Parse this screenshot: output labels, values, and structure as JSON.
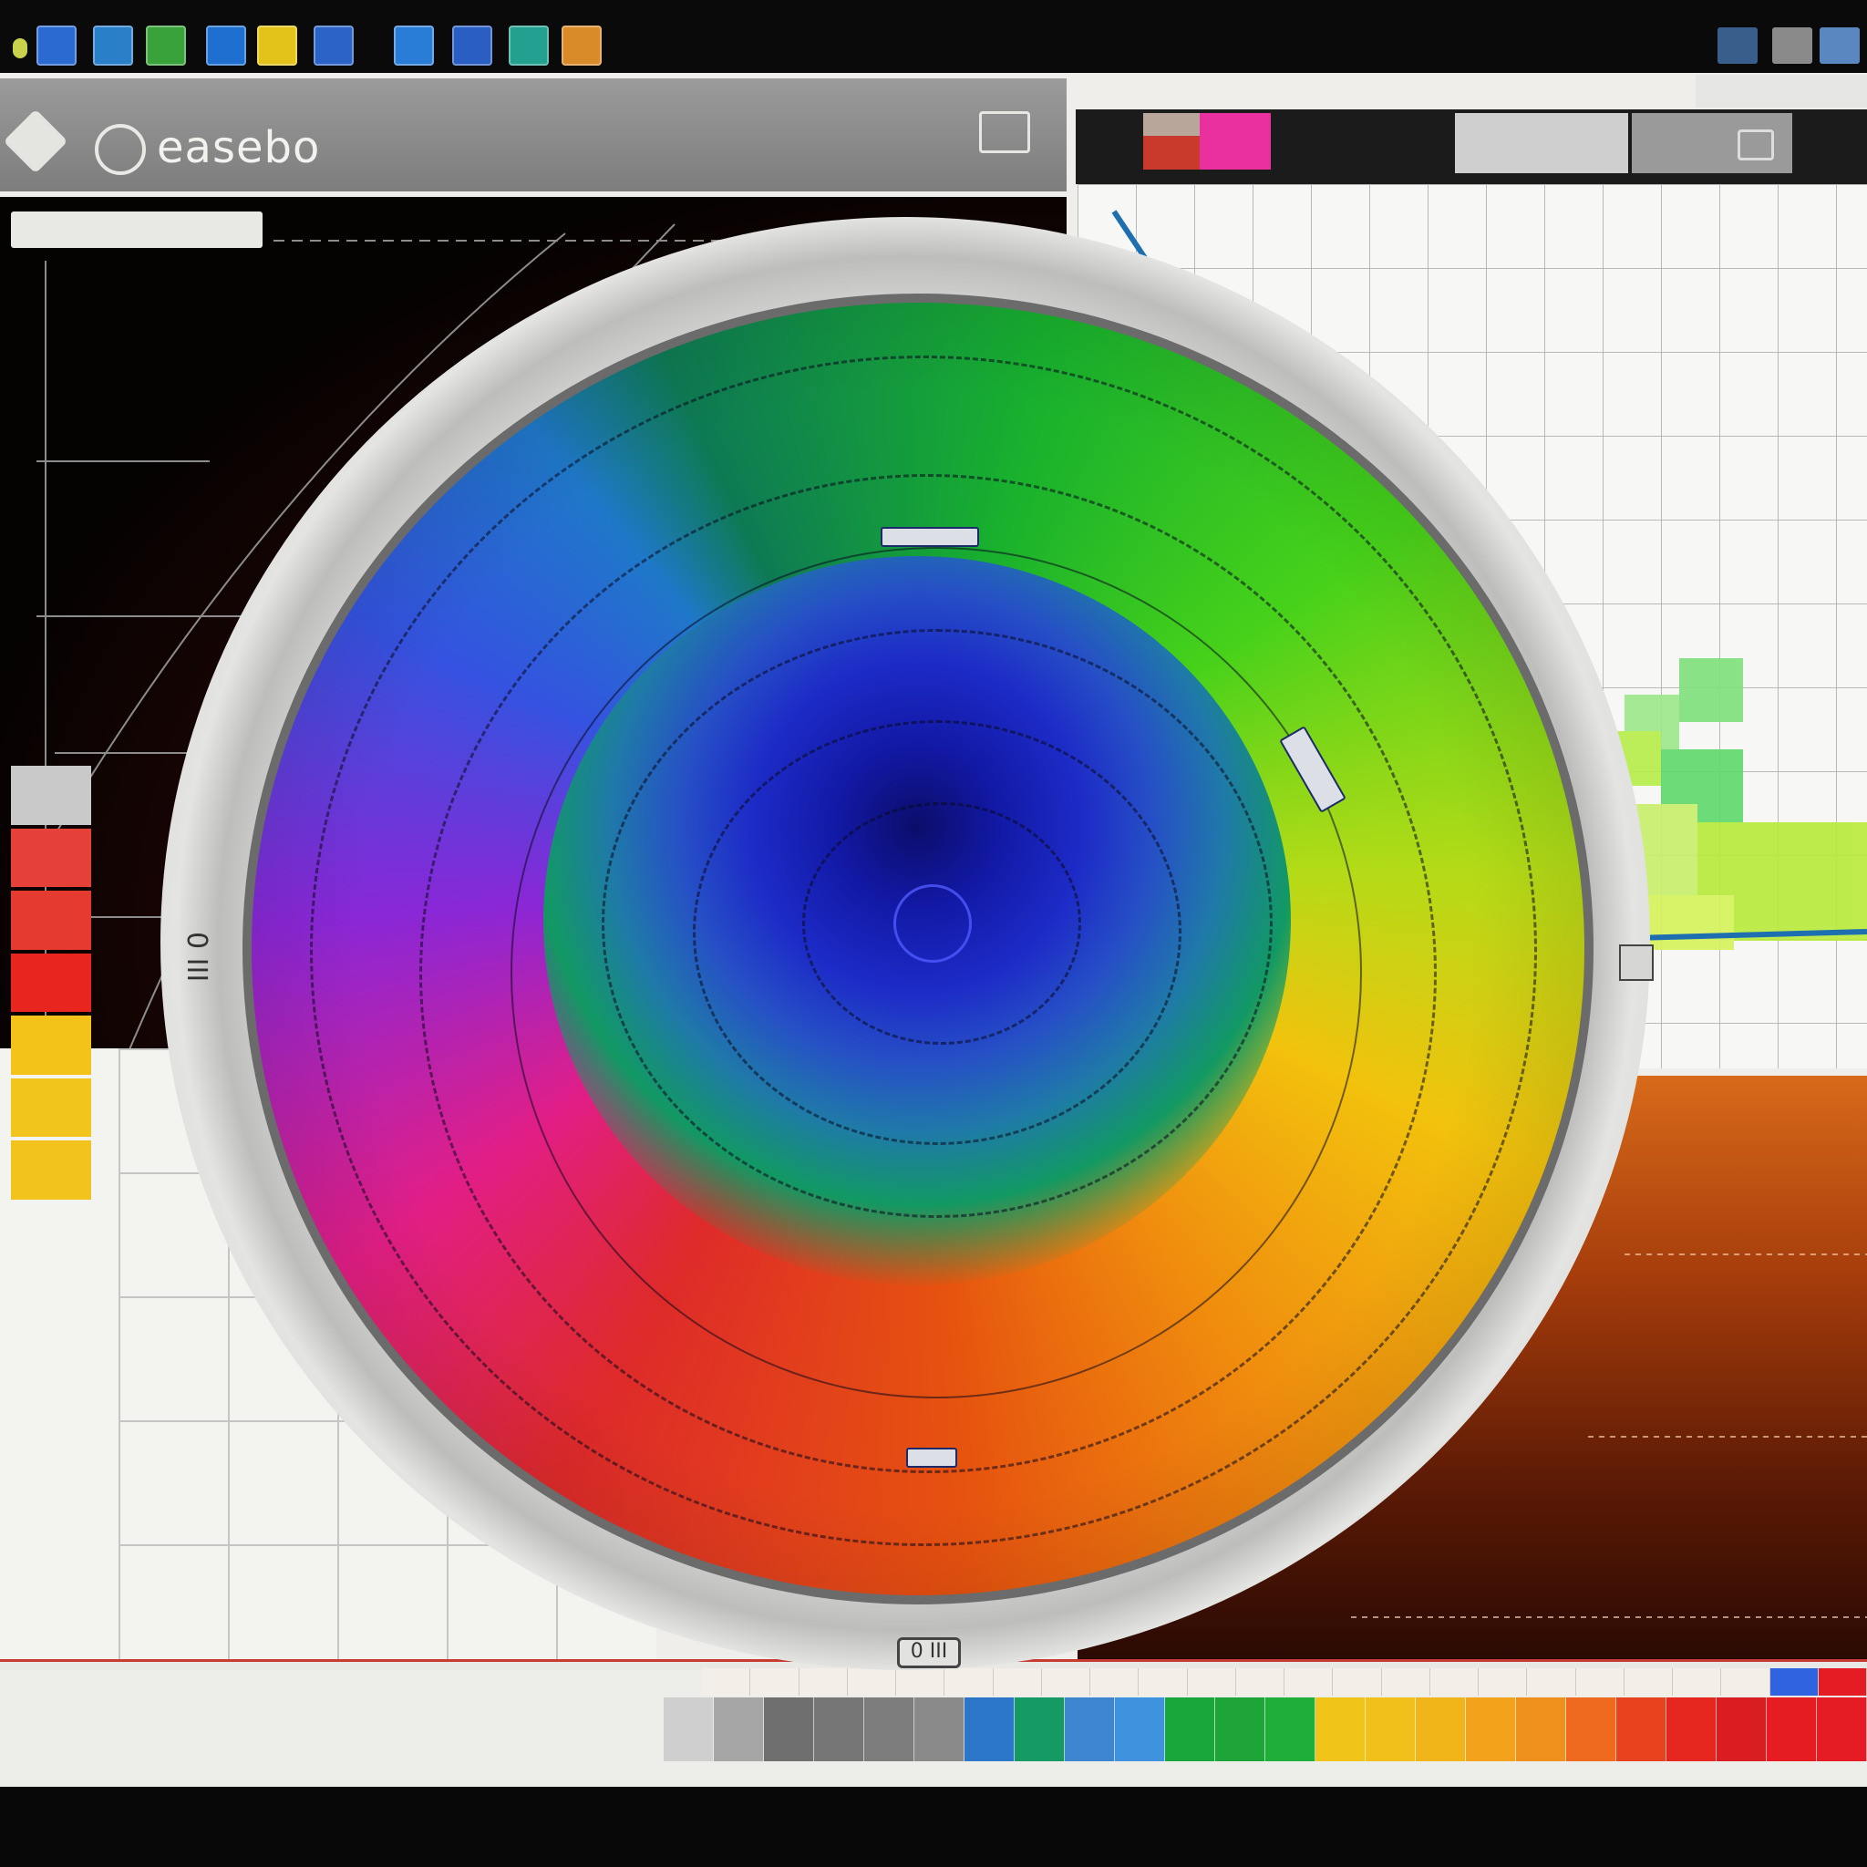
{
  "header": {
    "title": "easebo"
  },
  "toolbar": {
    "tools": [
      {
        "icon": "document-icon",
        "color": "#2b6bd1"
      },
      {
        "icon": "chart-icon",
        "color": "#2a7fc9"
      },
      {
        "icon": "image-icon",
        "color": "#3aa23a"
      },
      {
        "icon": "folder-icon",
        "color": "#1e6fcf"
      },
      {
        "icon": "note-icon",
        "color": "#e3c21a"
      },
      {
        "icon": "window-icon",
        "color": "#2b63c6"
      },
      {
        "icon": "table-icon",
        "color": "#2a7dd6"
      },
      {
        "icon": "book-icon",
        "color": "#2a5ec2"
      },
      {
        "icon": "map-icon",
        "color": "#23a08f"
      },
      {
        "icon": "brush-icon",
        "color": "#d98b2a"
      }
    ]
  },
  "viewer": {
    "left_label": "0 III",
    "bottom_label": "0 III"
  },
  "palette": {
    "swatches": [
      "#cfcfcf",
      "#a6a6a6",
      "#6f6f6f",
      "#767676",
      "#7d7d7d",
      "#8a8a8a",
      "#2c76c9",
      "#169a63",
      "#3f86d1",
      "#3f92dd",
      "#19a63a",
      "#1ea538",
      "#1fae3a",
      "#f0c419",
      "#f2c01a",
      "#f1b419",
      "#f2a21b",
      "#ef8f1c",
      "#ef6a1f",
      "#e9421f",
      "#e5271f",
      "#d91d21",
      "#e51d22",
      "#e51c24"
    ],
    "top_row": [
      "#f3efe8",
      "#f3efe8",
      "#f3efe8",
      "#f3efe8",
      "#f3efe8",
      "#f3efe8",
      "#f3efe8",
      "#f3efe8",
      "#f3efe8",
      "#f3efe8",
      "#f3efe8",
      "#f3efe8",
      "#f3efe8",
      "#f3efe8",
      "#f3efe8",
      "#f3efe8",
      "#f3efe8",
      "#f3efe8",
      "#f3efe8",
      "#f3efe8",
      "#f3efe8",
      "#f3efe8",
      "#2f63e0",
      "#e51c24"
    ]
  },
  "legend": {
    "colors": [
      "#c9c9c9",
      "#e64138",
      "#e53a30",
      "#e8261f",
      "#f3c31a",
      "#f1c51b",
      "#f2c31c"
    ]
  },
  "colors": {
    "accent": "#ea2f9e",
    "river": "#1e6fb0"
  }
}
